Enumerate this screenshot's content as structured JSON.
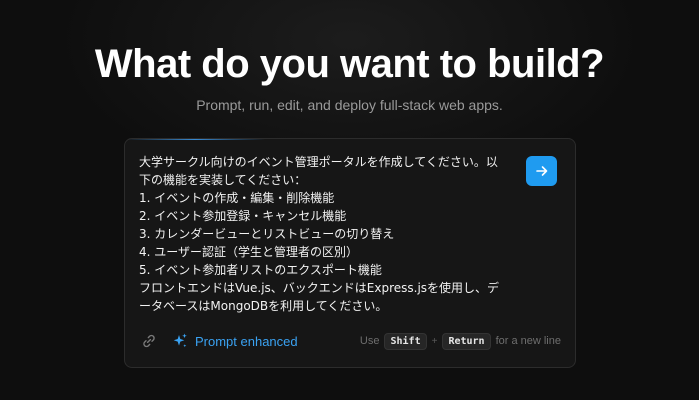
{
  "header": {
    "title": "What do you want to build?",
    "subtitle": "Prompt, run, edit, and deploy full-stack web apps."
  },
  "prompt": {
    "text": "大学サークル向けのイベント管理ポータルを作成してください。以\n下の機能を実装してください：\n1. イベントの作成・編集・削除機能\n2. イベント参加登録・キャンセル機能\n3. カレンダービューとリストビューの切り替え\n4. ユーザー認証（学生と管理者の区別）\n5. イベント参加者リストのエクスポート機能\nフロントエンドはVue.js、バックエンドはExpress.jsを使用し、デ\nータベースはMongoDBを利用してください。",
    "send_icon": "arrow-right-icon"
  },
  "footer": {
    "link_icon": "link-icon",
    "enhance_icon": "sparkles-icon",
    "enhance_label": "Prompt enhanced",
    "hint": {
      "use": "Use",
      "key1": "Shift",
      "plus": "+",
      "key2": "Return",
      "suffix": "for a new line"
    }
  },
  "colors": {
    "background": "#0e0e0e",
    "card": "#161616",
    "accent": "#1f9bf0",
    "enhance_text": "#3aa2f2"
  }
}
